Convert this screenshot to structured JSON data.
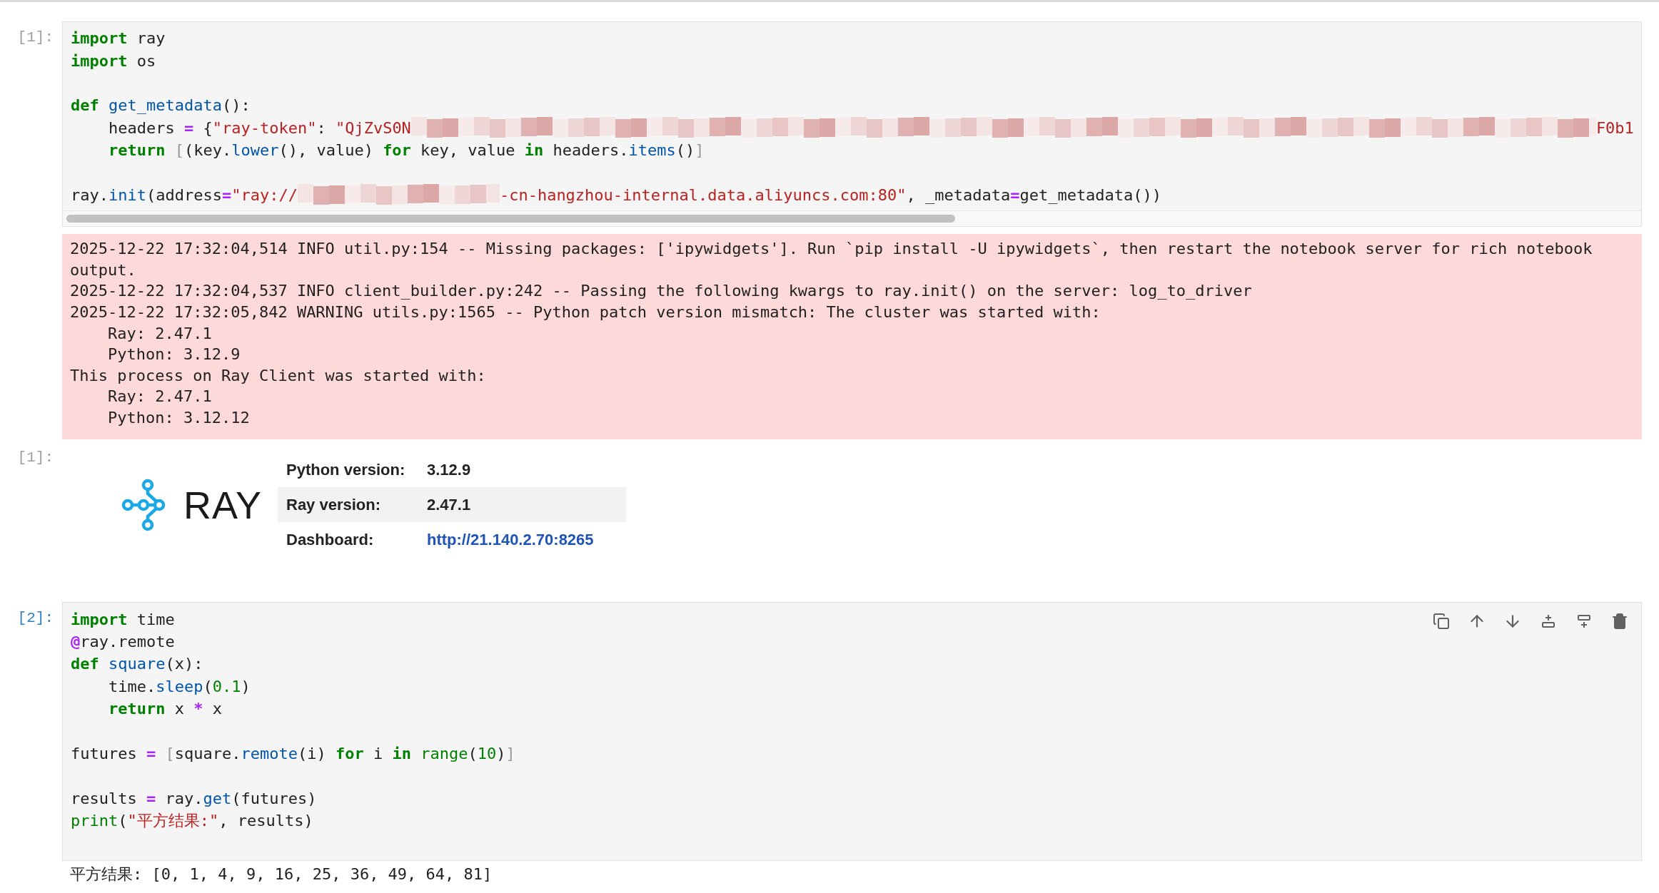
{
  "cells": [
    {
      "kind": "code",
      "prompt": "[1]:",
      "active": false,
      "scrollable": true,
      "lines": [
        {
          "kind": "code",
          "tokens": [
            {
              "text": "import",
              "kind": "keyword"
            },
            {
              "text": " ray",
              "kind": "plain"
            }
          ]
        },
        {
          "kind": "code",
          "tokens": [
            {
              "text": "import",
              "kind": "keyword"
            },
            {
              "text": " os",
              "kind": "plain"
            }
          ]
        },
        {
          "kind": "blank"
        },
        {
          "kind": "code",
          "tokens": [
            {
              "text": "def",
              "kind": "keyword"
            },
            {
              "text": " get_metadata",
              "kind": "function"
            },
            {
              "text": "():",
              "kind": "plain"
            }
          ]
        },
        {
          "kind": "code",
          "tokens": [
            {
              "text": "    headers ",
              "kind": "plain"
            },
            {
              "text": "=",
              "kind": "operator"
            },
            {
              "text": " {",
              "kind": "plain"
            },
            {
              "text": "\"ray-token\"",
              "kind": "string"
            },
            {
              "text": ": ",
              "kind": "plain"
            },
            {
              "text": "\"QjZvS0N",
              "kind": "string"
            },
            {
              "kind": "redacted"
            },
            {
              "text": "F0b1",
              "kind": "string"
            }
          ]
        },
        {
          "kind": "code",
          "tokens": [
            {
              "text": "    return",
              "kind": "keyword"
            },
            {
              "text": " [",
              "kind": "bracket"
            },
            {
              "text": "(key.",
              "kind": "plain"
            },
            {
              "text": "lower",
              "kind": "function"
            },
            {
              "text": "(), value) ",
              "kind": "plain"
            },
            {
              "text": "for",
              "kind": "keyword"
            },
            {
              "text": " key, value ",
              "kind": "plain"
            },
            {
              "text": "in",
              "kind": "keyword"
            },
            {
              "text": " headers.",
              "kind": "plain"
            },
            {
              "text": "items",
              "kind": "function"
            },
            {
              "text": "()",
              "kind": "plain"
            },
            {
              "text": "]",
              "kind": "bracket"
            }
          ]
        },
        {
          "kind": "blank"
        },
        {
          "kind": "code",
          "tokens": [
            {
              "text": "ray.",
              "kind": "plain"
            },
            {
              "text": "init",
              "kind": "function"
            },
            {
              "text": "(address",
              "kind": "plain"
            },
            {
              "text": "=",
              "kind": "operator"
            },
            {
              "text": "\"ray://",
              "kind": "string"
            },
            {
              "kind": "redacted"
            },
            {
              "text": "-cn-hangzhou-internal.data.aliyuncs.com:80\"",
              "kind": "string"
            },
            {
              "text": ", _metadata",
              "kind": "plain"
            },
            {
              "text": "=",
              "kind": "operator"
            },
            {
              "text": "get_metadata())",
              "kind": "plain"
            }
          ]
        }
      ]
    },
    {
      "kind": "stderr",
      "lines": [
        "2025-12-22 17:32:04,514 INFO util.py:154 -- Missing packages: ['ipywidgets']. Run `pip install -U ipywidgets`, then restart the notebook server for rich notebook output.",
        "2025-12-22 17:32:04,537 INFO client_builder.py:242 -- Passing the following kwargs to ray.init() on the server: log_to_driver",
        "2025-12-22 17:32:05,842 WARNING utils.py:1565 -- Python patch version mismatch: The cluster was started with:",
        "    Ray: 2.47.1",
        "    Python: 3.12.9",
        "This process on Ray Client was started with:",
        "    Ray: 2.47.1",
        "    Python: 3.12.12"
      ]
    },
    {
      "kind": "ray_info",
      "prompt": "[1]:",
      "logo": "RAY",
      "rows": [
        {
          "label": "Python version:",
          "value": "3.12.9",
          "kind": "text"
        },
        {
          "label": "Ray version:",
          "value": "2.47.1",
          "kind": "text"
        },
        {
          "label": "Dashboard:",
          "value": "http://21.140.2.70:8265",
          "kind": "link"
        }
      ]
    },
    {
      "kind": "code",
      "prompt": "[2]:",
      "active": true,
      "scrollable": false,
      "lines": [
        {
          "kind": "code",
          "tokens": [
            {
              "text": "import",
              "kind": "keyword"
            },
            {
              "text": " time",
              "kind": "plain"
            }
          ]
        },
        {
          "kind": "code",
          "tokens": [
            {
              "text": "@",
              "kind": "operator"
            },
            {
              "text": "ray.remote",
              "kind": "plain"
            }
          ]
        },
        {
          "kind": "code",
          "tokens": [
            {
              "text": "def",
              "kind": "keyword"
            },
            {
              "text": " square",
              "kind": "function"
            },
            {
              "text": "(x):",
              "kind": "plain"
            }
          ]
        },
        {
          "kind": "code",
          "tokens": [
            {
              "text": "    time.",
              "kind": "plain"
            },
            {
              "text": "sleep",
              "kind": "function"
            },
            {
              "text": "(",
              "kind": "plain"
            },
            {
              "text": "0.1",
              "kind": "number"
            },
            {
              "text": ")",
              "kind": "plain"
            }
          ]
        },
        {
          "kind": "code",
          "tokens": [
            {
              "text": "    return",
              "kind": "keyword"
            },
            {
              "text": " x ",
              "kind": "plain"
            },
            {
              "text": "*",
              "kind": "operator"
            },
            {
              "text": " x",
              "kind": "plain"
            }
          ]
        },
        {
          "kind": "blank"
        },
        {
          "kind": "code",
          "tokens": [
            {
              "text": "futures ",
              "kind": "plain"
            },
            {
              "text": "=",
              "kind": "operator"
            },
            {
              "text": " [",
              "kind": "bracket"
            },
            {
              "text": "square.",
              "kind": "plain"
            },
            {
              "text": "remote",
              "kind": "function"
            },
            {
              "text": "(i) ",
              "kind": "plain"
            },
            {
              "text": "for",
              "kind": "keyword"
            },
            {
              "text": " i ",
              "kind": "plain"
            },
            {
              "text": "in",
              "kind": "keyword"
            },
            {
              "text": " range",
              "kind": "builtin"
            },
            {
              "text": "(",
              "kind": "plain"
            },
            {
              "text": "10",
              "kind": "number"
            },
            {
              "text": ")",
              "kind": "plain"
            },
            {
              "text": "]",
              "kind": "bracket"
            }
          ]
        },
        {
          "kind": "blank"
        },
        {
          "kind": "code",
          "tokens": [
            {
              "text": "results ",
              "kind": "plain"
            },
            {
              "text": "=",
              "kind": "operator"
            },
            {
              "text": " ray.",
              "kind": "plain"
            },
            {
              "text": "get",
              "kind": "function"
            },
            {
              "text": "(futures)",
              "kind": "plain"
            }
          ]
        },
        {
          "kind": "code",
          "tokens": [
            {
              "text": "print",
              "kind": "builtin"
            },
            {
              "text": "(",
              "kind": "plain"
            },
            {
              "text": "\"平方结果:\"",
              "kind": "string"
            },
            {
              "text": ", results)",
              "kind": "plain"
            }
          ]
        }
      ]
    },
    {
      "kind": "stdout",
      "lines": [
        "平方结果: [0, 1, 4, 9, 16, 25, 36, 49, 64, 81]"
      ]
    }
  ]
}
